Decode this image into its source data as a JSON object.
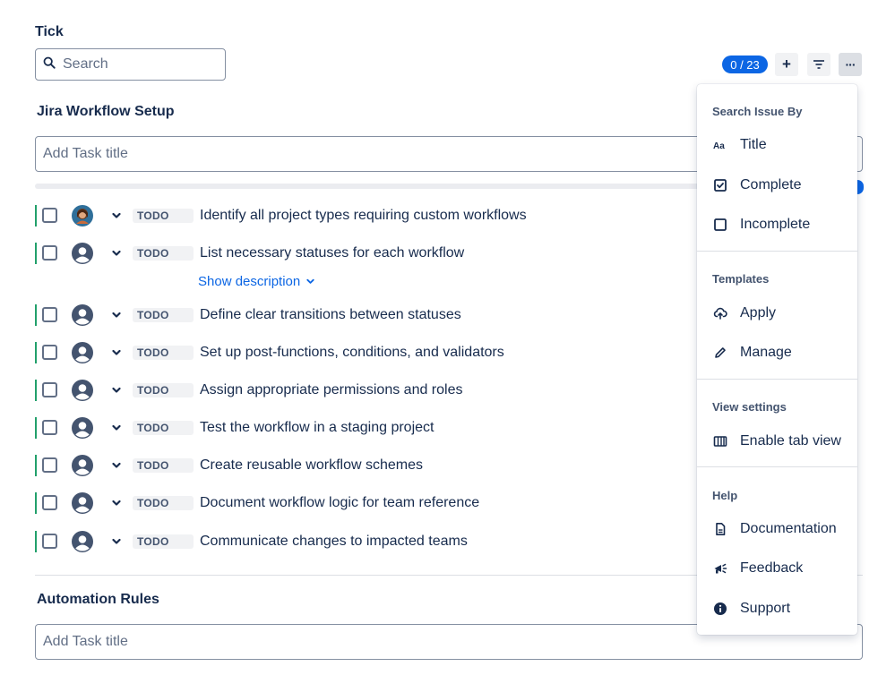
{
  "app": {
    "title": "Tick"
  },
  "search": {
    "placeholder": "Search"
  },
  "toolbar": {
    "counter": "0 / 23",
    "add_symbol": "+",
    "more_symbol": "···"
  },
  "sections": [
    {
      "title": "Jira Workflow Setup",
      "input_placeholder": "Add Task title"
    },
    {
      "title": "Automation Rules",
      "input_placeholder": "Add Task title"
    }
  ],
  "status_label": "TODO",
  "tasks": [
    {
      "title": "Identify all project types requiring custom workflows",
      "avatar": "photo"
    },
    {
      "title": "List necessary statuses for each workflow",
      "avatar": "default"
    },
    {
      "title": "Define clear transitions between statuses",
      "avatar": "default"
    },
    {
      "title": "Set up post-functions, conditions, and validators",
      "avatar": "default"
    },
    {
      "title": "Assign appropriate permissions and roles",
      "avatar": "default"
    },
    {
      "title": "Test the workflow in a staging project",
      "avatar": "default"
    },
    {
      "title": "Create reusable workflow schemes",
      "avatar": "default"
    },
    {
      "title": "Document workflow logic for team reference",
      "avatar": "default"
    },
    {
      "title": "Communicate changes to impacted teams",
      "avatar": "default"
    }
  ],
  "show_description": "Show description",
  "menu": {
    "groups": [
      {
        "title": "Search Issue By",
        "items": [
          {
            "label": "Title",
            "icon": "text-case-icon"
          },
          {
            "label": "Complete",
            "icon": "checkbox-checked-icon"
          },
          {
            "label": "Incomplete",
            "icon": "checkbox-empty-icon"
          }
        ]
      },
      {
        "title": "Templates",
        "items": [
          {
            "label": "Apply",
            "icon": "cloud-upload-icon"
          },
          {
            "label": "Manage",
            "icon": "pencil-icon"
          }
        ]
      },
      {
        "title": "View settings",
        "items": [
          {
            "label": "Enable tab view",
            "icon": "tab-view-icon"
          }
        ]
      },
      {
        "title": "Help",
        "items": [
          {
            "label": "Documentation",
            "icon": "document-icon"
          },
          {
            "label": "Feedback",
            "icon": "megaphone-icon"
          },
          {
            "label": "Support",
            "icon": "info-icon"
          }
        ]
      }
    ]
  },
  "colors": {
    "accent": "#0c66e4",
    "row_bar": "#22a06b",
    "text": "#172b4d",
    "lozenge_bg": "#f1f2f4"
  }
}
